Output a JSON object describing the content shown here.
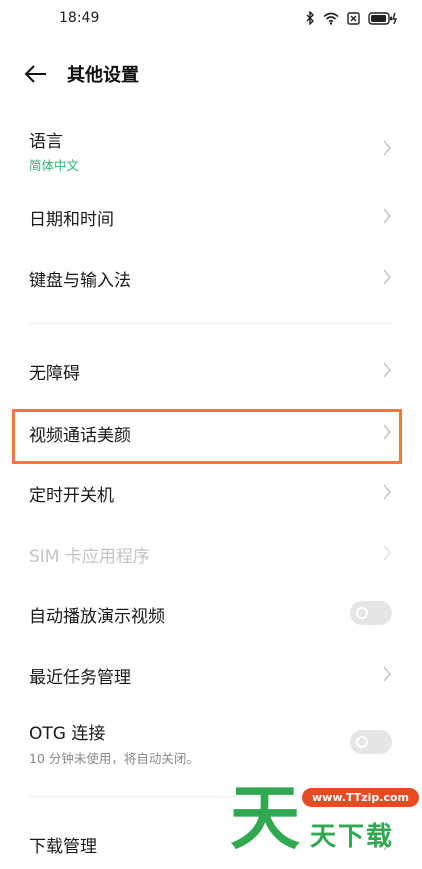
{
  "status": {
    "time": "18:49"
  },
  "header": {
    "title": "其他设置"
  },
  "items": [
    {
      "label": "语言",
      "sub": "简体中文"
    },
    {
      "label": "日期和时间"
    },
    {
      "label": "键盘与输入法"
    },
    {
      "label": "无障碍"
    },
    {
      "label": "视频通话美颜"
    },
    {
      "label": "定时开关机"
    },
    {
      "label": "SIM 卡应用程序"
    },
    {
      "label": "自动播放演示视频"
    },
    {
      "label": "最近任务管理"
    },
    {
      "label": "OTG 连接",
      "sub": "10 分钟未使用，将自动关闭。"
    },
    {
      "label": "下载管理"
    }
  ],
  "watermark": {
    "big": "天",
    "url": "www.TTzip.com",
    "text": "天下载"
  },
  "colors": {
    "accent": "#2bb673",
    "highlight": "#f07840",
    "disabled": "#c4c4c4"
  }
}
